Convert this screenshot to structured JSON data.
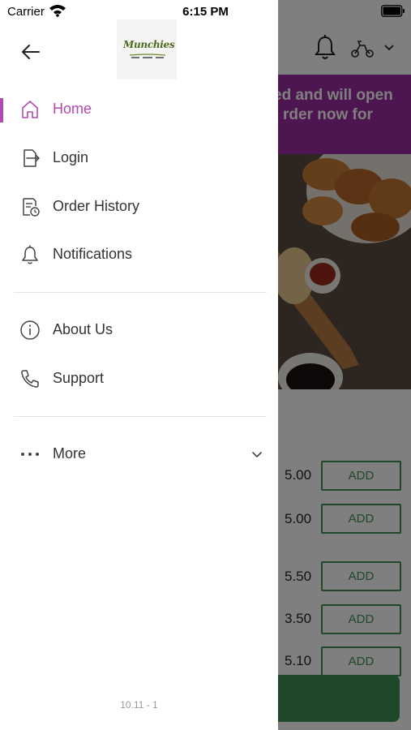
{
  "status_bar": {
    "carrier": "Carrier",
    "time": "6:15 PM"
  },
  "drawer": {
    "logo_text": "Munchies",
    "menu": [
      {
        "label": "Home",
        "icon": "home-icon",
        "active": true
      },
      {
        "label": "Login",
        "icon": "login-icon"
      },
      {
        "label": "Order History",
        "icon": "order-history-icon"
      },
      {
        "label": "Notifications",
        "icon": "bell-icon"
      },
      {
        "label": "About Us",
        "icon": "info-icon"
      },
      {
        "label": "Support",
        "icon": "phone-icon"
      },
      {
        "label": "More",
        "icon": "more-dots-icon"
      }
    ],
    "version": "10.11 - 1",
    "accent_color": "#b249b2"
  },
  "background": {
    "banner_line1": "ed and will open",
    "banner_line2": "rder now for",
    "banner_color": "#9c2ca0",
    "add_label": "ADD",
    "prices": [
      "5.00",
      "5.00",
      "5.50",
      "3.50",
      "5.10"
    ],
    "button_color": "#3f8e55"
  }
}
